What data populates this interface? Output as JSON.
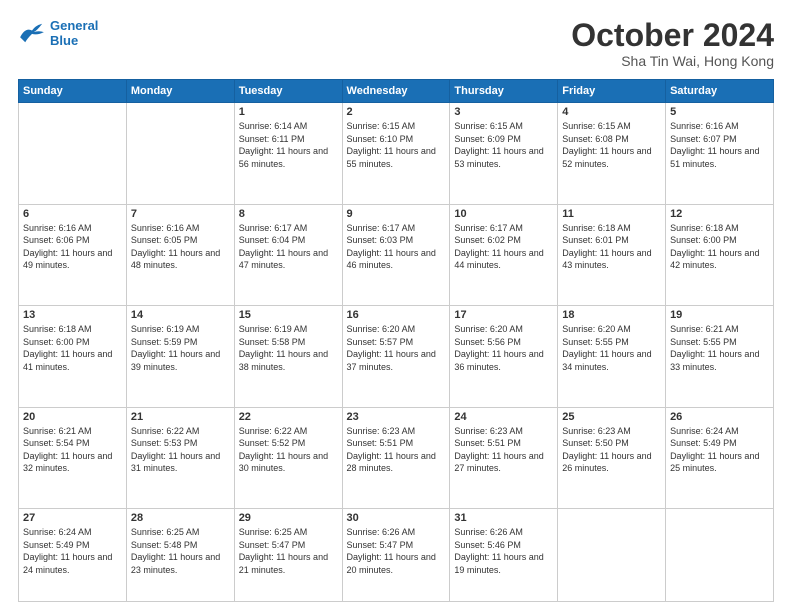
{
  "header": {
    "logo_line1": "General",
    "logo_line2": "Blue",
    "title": "October 2024",
    "subtitle": "Sha Tin Wai, Hong Kong"
  },
  "calendar": {
    "days_of_week": [
      "Sunday",
      "Monday",
      "Tuesday",
      "Wednesday",
      "Thursday",
      "Friday",
      "Saturday"
    ],
    "weeks": [
      [
        {
          "day": "",
          "info": ""
        },
        {
          "day": "",
          "info": ""
        },
        {
          "day": "1",
          "info": "Sunrise: 6:14 AM\nSunset: 6:11 PM\nDaylight: 11 hours\nand 56 minutes."
        },
        {
          "day": "2",
          "info": "Sunrise: 6:15 AM\nSunset: 6:10 PM\nDaylight: 11 hours\nand 55 minutes."
        },
        {
          "day": "3",
          "info": "Sunrise: 6:15 AM\nSunset: 6:09 PM\nDaylight: 11 hours\nand 53 minutes."
        },
        {
          "day": "4",
          "info": "Sunrise: 6:15 AM\nSunset: 6:08 PM\nDaylight: 11 hours\nand 52 minutes."
        },
        {
          "day": "5",
          "info": "Sunrise: 6:16 AM\nSunset: 6:07 PM\nDaylight: 11 hours\nand 51 minutes."
        }
      ],
      [
        {
          "day": "6",
          "info": "Sunrise: 6:16 AM\nSunset: 6:06 PM\nDaylight: 11 hours\nand 49 minutes."
        },
        {
          "day": "7",
          "info": "Sunrise: 6:16 AM\nSunset: 6:05 PM\nDaylight: 11 hours\nand 48 minutes."
        },
        {
          "day": "8",
          "info": "Sunrise: 6:17 AM\nSunset: 6:04 PM\nDaylight: 11 hours\nand 47 minutes."
        },
        {
          "day": "9",
          "info": "Sunrise: 6:17 AM\nSunset: 6:03 PM\nDaylight: 11 hours\nand 46 minutes."
        },
        {
          "day": "10",
          "info": "Sunrise: 6:17 AM\nSunset: 6:02 PM\nDaylight: 11 hours\nand 44 minutes."
        },
        {
          "day": "11",
          "info": "Sunrise: 6:18 AM\nSunset: 6:01 PM\nDaylight: 11 hours\nand 43 minutes."
        },
        {
          "day": "12",
          "info": "Sunrise: 6:18 AM\nSunset: 6:00 PM\nDaylight: 11 hours\nand 42 minutes."
        }
      ],
      [
        {
          "day": "13",
          "info": "Sunrise: 6:18 AM\nSunset: 6:00 PM\nDaylight: 11 hours\nand 41 minutes."
        },
        {
          "day": "14",
          "info": "Sunrise: 6:19 AM\nSunset: 5:59 PM\nDaylight: 11 hours\nand 39 minutes."
        },
        {
          "day": "15",
          "info": "Sunrise: 6:19 AM\nSunset: 5:58 PM\nDaylight: 11 hours\nand 38 minutes."
        },
        {
          "day": "16",
          "info": "Sunrise: 6:20 AM\nSunset: 5:57 PM\nDaylight: 11 hours\nand 37 minutes."
        },
        {
          "day": "17",
          "info": "Sunrise: 6:20 AM\nSunset: 5:56 PM\nDaylight: 11 hours\nand 36 minutes."
        },
        {
          "day": "18",
          "info": "Sunrise: 6:20 AM\nSunset: 5:55 PM\nDaylight: 11 hours\nand 34 minutes."
        },
        {
          "day": "19",
          "info": "Sunrise: 6:21 AM\nSunset: 5:55 PM\nDaylight: 11 hours\nand 33 minutes."
        }
      ],
      [
        {
          "day": "20",
          "info": "Sunrise: 6:21 AM\nSunset: 5:54 PM\nDaylight: 11 hours\nand 32 minutes."
        },
        {
          "day": "21",
          "info": "Sunrise: 6:22 AM\nSunset: 5:53 PM\nDaylight: 11 hours\nand 31 minutes."
        },
        {
          "day": "22",
          "info": "Sunrise: 6:22 AM\nSunset: 5:52 PM\nDaylight: 11 hours\nand 30 minutes."
        },
        {
          "day": "23",
          "info": "Sunrise: 6:23 AM\nSunset: 5:51 PM\nDaylight: 11 hours\nand 28 minutes."
        },
        {
          "day": "24",
          "info": "Sunrise: 6:23 AM\nSunset: 5:51 PM\nDaylight: 11 hours\nand 27 minutes."
        },
        {
          "day": "25",
          "info": "Sunrise: 6:23 AM\nSunset: 5:50 PM\nDaylight: 11 hours\nand 26 minutes."
        },
        {
          "day": "26",
          "info": "Sunrise: 6:24 AM\nSunset: 5:49 PM\nDaylight: 11 hours\nand 25 minutes."
        }
      ],
      [
        {
          "day": "27",
          "info": "Sunrise: 6:24 AM\nSunset: 5:49 PM\nDaylight: 11 hours\nand 24 minutes."
        },
        {
          "day": "28",
          "info": "Sunrise: 6:25 AM\nSunset: 5:48 PM\nDaylight: 11 hours\nand 23 minutes."
        },
        {
          "day": "29",
          "info": "Sunrise: 6:25 AM\nSunset: 5:47 PM\nDaylight: 11 hours\nand 21 minutes."
        },
        {
          "day": "30",
          "info": "Sunrise: 6:26 AM\nSunset: 5:47 PM\nDaylight: 11 hours\nand 20 minutes."
        },
        {
          "day": "31",
          "info": "Sunrise: 6:26 AM\nSunset: 5:46 PM\nDaylight: 11 hours\nand 19 minutes."
        },
        {
          "day": "",
          "info": ""
        },
        {
          "day": "",
          "info": ""
        }
      ]
    ]
  }
}
